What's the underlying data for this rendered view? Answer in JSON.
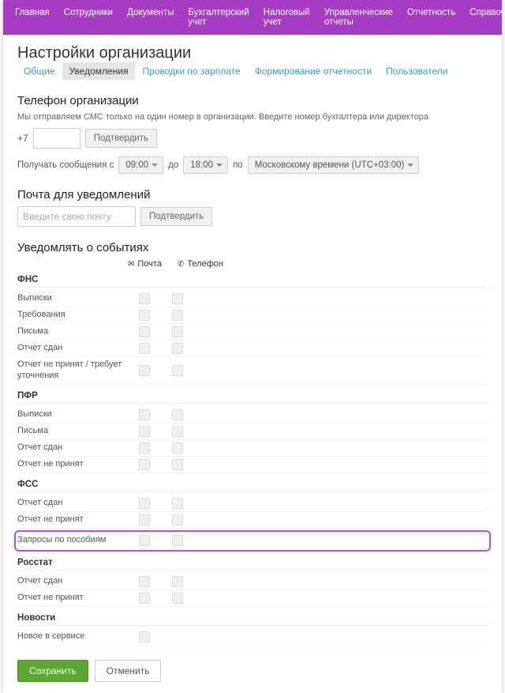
{
  "nav": [
    "Главная",
    "Сотрудники",
    "Документы",
    "Бухгалтерский учет",
    "Налоговый учет",
    "Управленческие отчеты",
    "Отчетность",
    "Справочники"
  ],
  "page_title": "Настройки организации",
  "tabs": [
    {
      "label": "Общие",
      "active": false
    },
    {
      "label": "Уведомления",
      "active": true
    },
    {
      "label": "Проводки по зарплате",
      "active": false
    },
    {
      "label": "Формирование отчетности",
      "active": false
    },
    {
      "label": "Пользователи",
      "active": false
    }
  ],
  "phone": {
    "heading": "Телефон организации",
    "hint": "Мы отправляем СМС только на один номер в организации. Введите номер бухгалтера или директора",
    "prefix": "+7",
    "value": "",
    "confirm": "Подтвердить",
    "receive_label": "Получать сообщения с",
    "from": "09:00",
    "to_word": "до",
    "to": "18:00",
    "by_word": "по",
    "tz": "Московскому времени (UTC+03:00)"
  },
  "email": {
    "heading": "Почта для уведомлений",
    "placeholder": "Введите свою почту",
    "confirm": "Подтвердить"
  },
  "events": {
    "heading": "Уведомлять о событиях",
    "col_mail": "Почта",
    "col_phone": "Телефон",
    "sections": [
      {
        "title": "ФНС",
        "rows": [
          "Выписки",
          "Требования",
          "Письма",
          "Отчет сдан",
          "Отчет не принят / требует уточнения"
        ]
      },
      {
        "title": "ПФР",
        "rows": [
          "Выписки",
          "Письма",
          "Отчет сдан",
          "Отчет не принят"
        ]
      },
      {
        "title": "ФСС",
        "rows": [
          "Отчет сдан",
          "Отчет не принят",
          "Запросы по пособиям"
        ]
      },
      {
        "title": "Росстат",
        "rows": [
          "Отчет сдан",
          "Отчет не принят"
        ]
      },
      {
        "title": "Новости",
        "rows": [
          "Новое в сервисе"
        ],
        "single": true
      }
    ],
    "highlight": "Запросы по пособиям"
  },
  "actions": {
    "save": "Сохранить",
    "cancel": "Отменить"
  }
}
